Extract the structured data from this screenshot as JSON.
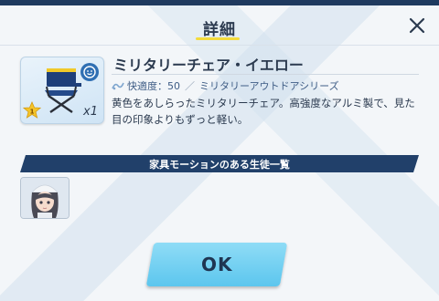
{
  "dialog": {
    "title": "詳細",
    "close_icon": "close-icon"
  },
  "item": {
    "name": "ミリタリーチェア・イエロー",
    "quantity": "x1",
    "rarity_stars": 1,
    "icon": "folding-chair-icon",
    "comfort_label": "快適度：50",
    "series": "ミリタリーアウトドアシリーズ",
    "description": "黄色をあしらったミリタリーチェア。高強度なアルミ製で、見た目の印象よりもずっと軽い。"
  },
  "section": {
    "title": "家具モーションのある生徒一覧"
  },
  "students": [
    {
      "icon": "student-portrait"
    }
  ],
  "buttons": {
    "ok_label": "OK"
  },
  "colors": {
    "accent_yellow": "#f3db3c",
    "section_bar": "#21406a",
    "ok_button": "#6fcff1",
    "text_dark": "#2b3a4f"
  }
}
